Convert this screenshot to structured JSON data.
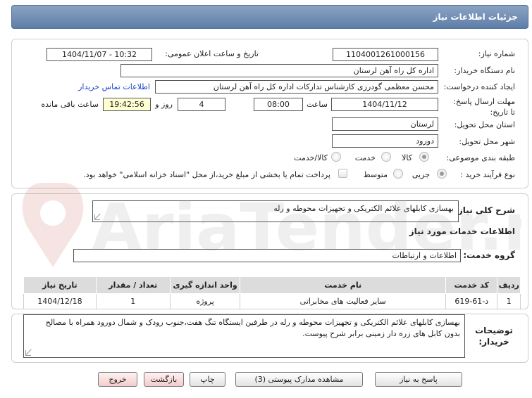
{
  "header": {
    "title": "جزئیات اطلاعات نیاز"
  },
  "fields": {
    "need_number_label": "شماره نیاز:",
    "need_number": "1104001261000156",
    "announce_label": "تاریخ و ساعت اعلان عمومی:",
    "announce_value": "1404/11/07 - 10:32",
    "buyer_org_label": "نام دستگاه خریدار:",
    "buyer_org": "اداره کل راه آهن لرستان",
    "creator_label": "ایجاد کننده درخواست:",
    "creator": "محسن معظمی گودرزی کارشناس تدارکات اداره کل راه آهن لرستان",
    "contact_link": "اطلاعات تماس خریدار",
    "deadline_label": "مهلت ارسال پاسخ: تا تاریخ:",
    "deadline_date": "1404/11/12",
    "time_label": "ساعت",
    "deadline_time": "08:00",
    "days_value": "4",
    "days_label": "روز و",
    "remaining_time": "19:42:56",
    "remaining_label": "ساعت باقی مانده",
    "province_label": "استان محل تحویل:",
    "province": "لرستان",
    "city_label": "شهر محل تحویل:",
    "city": "دورود",
    "category_label": "طبقه بندی موضوعی:",
    "category_options": [
      "کالا",
      "خدمت",
      "کالا/خدمت"
    ],
    "process_label": "نوع فرآیند خرید :",
    "process_options": [
      "جزیی",
      "متوسط"
    ],
    "payment_note": "پرداخت تمام یا بخشی از مبلغ خرید،از محل \"اسناد خزانه اسلامی\" خواهد بود."
  },
  "description": {
    "label": "شرح کلی نیاز:",
    "value": "بهسازی کابلهای علائم الکتریکی و تجهیزات محوطه و رله"
  },
  "services": {
    "section_title": "اطلاعات خدمات مورد نیاز",
    "group_label": "گروه خدمت:",
    "group_value": "اطلاعات و ارتباطات",
    "columns": [
      "ردیف",
      "کد خدمت",
      "نام خدمت",
      "واحد اندازه گیری",
      "تعداد / مقدار",
      "تاریخ نیاز"
    ],
    "rows": [
      [
        "1",
        "د-61-619",
        "سایر فعالیت های مخابراتی",
        "پروژه",
        "1",
        "1404/12/18"
      ]
    ]
  },
  "buyer_notes": {
    "label": "توضیحات خریدار:",
    "value": "بهسازی کابلهای علائم الکتریکی و تجهیزات محوطه و رله در طرفین ایستگاه تنگ هفت،جنوب رودک و شمال دورود همراه با مصالح بدون کابل های زره دار زمینی برابر شرح پیوست."
  },
  "buttons": {
    "respond": "پاسخ به نیاز",
    "attachments": "مشاهده مدارک پیوستی (3)",
    "print": "چاپ",
    "back": "بازگشت",
    "exit": "خروج"
  },
  "watermark": {
    "text": "AriaTender.net"
  },
  "colors": {
    "header": "#6f8db5",
    "link": "#1a44c9",
    "time_bg": "#ffffd2",
    "pink_button": "#f4cccc"
  }
}
